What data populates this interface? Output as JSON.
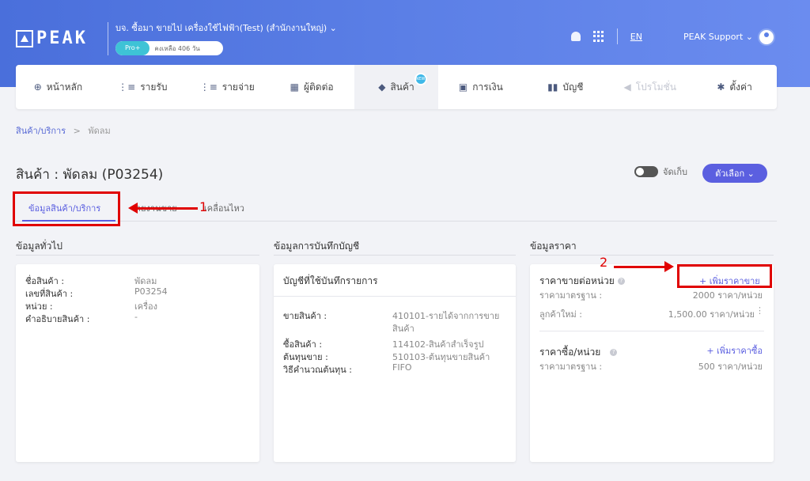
{
  "header": {
    "logo_text": "PEAK",
    "company_name": "บจ. ซื้อมา ขายไป เครื่องใช้ไฟฟ้า(Test) (สำนักงานใหญ่) ⌄",
    "plan": "Pro+",
    "plan_remaining": "คงเหลือ 406 วัน",
    "language": "EN",
    "user_name": "PEAK Support ⌄"
  },
  "nav": {
    "items": [
      {
        "label": "หน้าหลัก",
        "icon": "dashboard-icon",
        "glyph": "⊕"
      },
      {
        "label": "รายรับ",
        "icon": "income-icon",
        "glyph": "⋮≡"
      },
      {
        "label": "รายจ่าย",
        "icon": "expense-icon",
        "glyph": "⋮≡"
      },
      {
        "label": "ผู้ติดต่อ",
        "icon": "contacts-icon",
        "glyph": "▦"
      },
      {
        "label": "สินค้า",
        "icon": "products-icon",
        "glyph": "◆"
      },
      {
        "label": "การเงิน",
        "icon": "finance-icon",
        "glyph": "▣"
      },
      {
        "label": "บัญชี",
        "icon": "accounting-icon",
        "glyph": "▮▮"
      },
      {
        "label": "โปรโมชั่น",
        "icon": "promotion-icon",
        "glyph": "◀"
      },
      {
        "label": "ตั้งค่า",
        "icon": "settings-icon",
        "glyph": "✱"
      }
    ],
    "new_badge": "NEW"
  },
  "breadcrumb": {
    "parent": "สินค้า/บริการ",
    "separator": ">",
    "current": "พัดลม"
  },
  "page": {
    "title": "สินค้า : พัดลม (P03254)",
    "archive_label": "จัดเก็บ",
    "options_label": "ตัวเลือก ⌄"
  },
  "tabs": [
    {
      "label": "ข้อมูลสินค้า/บริการ"
    },
    {
      "label": "รายงานขาย"
    },
    {
      "label": "เคลื่อนไหว"
    }
  ],
  "annotations": {
    "marker1": "1",
    "marker2": "2"
  },
  "general": {
    "section_title": "ข้อมูลทั่วไป",
    "rows": [
      {
        "label": "ชื่อสินค้า :",
        "value": "พัดลม"
      },
      {
        "label": "เลขที่สินค้า :",
        "value": "P03254"
      },
      {
        "label": "หน่วย :",
        "value": "เครื่อง"
      },
      {
        "label": "คำอธิบายสินค้า :",
        "value": "-"
      }
    ]
  },
  "accounting": {
    "section_title": "ข้อมูลการบันทึกบัญชี",
    "card_title": "บัญชีที่ใช้บันทึกรายการ",
    "sales_label": "ขายสินค้า :",
    "sales_value_line1": "410101-รายได้จากการขาย",
    "sales_value_line2": "สินค้า",
    "purchase_label": "ซื้อสินค้า :",
    "purchase_value": "114102-สินค้าสำเร็จรูป",
    "cogs_label": "ต้นทุนขาย :",
    "cogs_value": "510103-ต้นทุนขายสินค้า",
    "method_label": "วิธีคำนวณต้นทุน :",
    "method_value": "FIFO"
  },
  "pricing": {
    "section_title": "ข้อมูลราคา",
    "sell_title": "ราคาขายต่อหน่วย",
    "add_sell_price": "+ เพิ่มราคาขาย",
    "sell_std_label": "ราคามาตรฐาน :",
    "sell_std_value": "2000 ราคา/หน่วย",
    "new_customer_label": "ลูกค้าใหม่ :",
    "new_customer_value": "1,500.00 ราคา/หน่วย",
    "buy_title": "ราคาซื้อ/หน่วย",
    "add_buy_price": "+ เพิ่มราคาซื้อ",
    "buy_std_label": "ราคามาตรฐาน :",
    "buy_std_value": "500 ราคา/หน่วย"
  }
}
